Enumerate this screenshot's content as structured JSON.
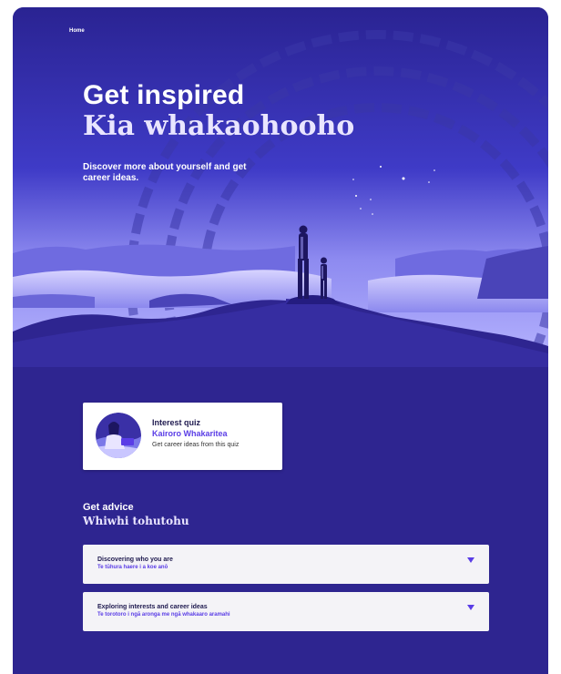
{
  "breadcrumb": {
    "home": "Home"
  },
  "hero": {
    "title_en": "Get inspired",
    "title_mi": "Kia whakaohooho",
    "intro": "Discover more about yourself and get career ideas."
  },
  "quiz_card": {
    "title": "Interest quiz",
    "subtitle": "Kairoro Whakaritea",
    "description": "Get career ideas from this quiz"
  },
  "advice": {
    "heading_en": "Get advice",
    "heading_mi": "Whiwhi tohutohu",
    "items": [
      {
        "title": "Discovering who you are",
        "subtitle": "Te tūhura haere i a koe anō"
      },
      {
        "title": "Exploring interests and career ideas",
        "subtitle": "Te torotoro i ngā aronga me ngā whakaaro aramahi"
      }
    ]
  },
  "colors": {
    "background": "#2e2590",
    "accent": "#5a3de6",
    "card": "#ffffff",
    "accordion": "#f4f3f7"
  },
  "icons": [
    "chevron-down-icon",
    "quiz-illustration"
  ]
}
